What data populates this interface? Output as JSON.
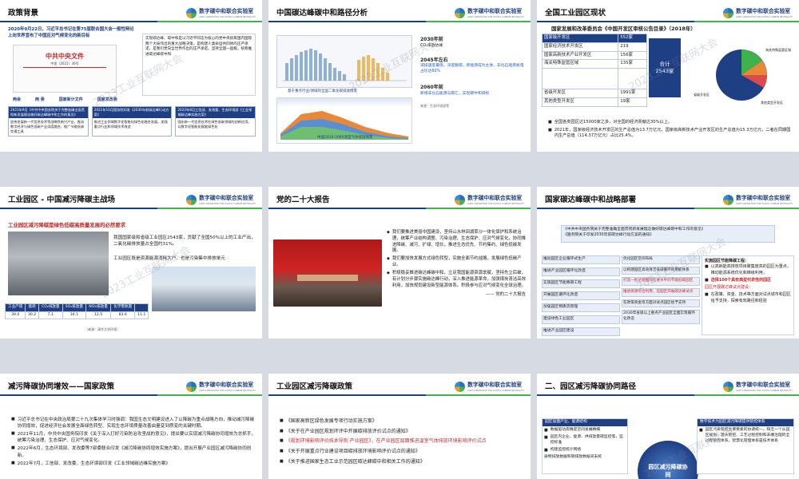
{
  "brand": {
    "name": "数字碳中和联合实验室",
    "en": "JOINT LABORATORY FOR DIGITAL CARBON NEUTRALITY"
  },
  "watermark": "2023工业互联网大会",
  "slides": [
    {
      "title": "政策背景",
      "intro": "2020年9月22日，习近平总书记在第75届联合国大会一般性辩论上向世界宣布了中国应对气候变化的新目标",
      "doc_title": "中共中央文件",
      "doc_num": "中发〔2021〕36号",
      "right_text": "实现碳达峰、碳中和是以习近平同志为核心的党中央统筹国内国际两个大局作出的重大战略决策，是构建人类命运共同体的庄严承诺，是我们党向全世界作出的庄严承诺。坚持全国一盘棋，统筹推进碳达峰碳中和",
      "labels": [
        "两会",
        "两 委",
        "国家新计文件",
        "国家发改委"
      ],
      "blocks": [
        {
          "head": "2021年9月《中共中央国务院关于完整准确全面贯彻新发展理念做好碳达峰碳中和工作的意见》",
          "body": "加快发展新一代信息技术等战略性新兴产业，推动数字经济与绿色低碳产业深度融合，推广节能低碳交通工具"
        },
        {
          "head": "2021年10月国务院印发《2030年前碳达峰行动方案》",
          "body": "推进工业领域数字化智能化绿色化融合发展，加强重点行业和领域技术改造"
        },
        {
          "head": "2022年8月工信部、发改委、生态环境部《工业领域碳达峰实施方案》",
          "body": "强化新一代信息技术在绿色低碳领域的创新应用，以数字化智能化赋能绿色化"
        }
      ]
    },
    {
      "title": "中国碳达峰碳中和路径分析",
      "chart_caption": "中国2020-2060温室气体排放情景",
      "chart_sub": "基于重点行业/领域的全国二氧化碳排放情景",
      "y2030": "2030年前",
      "t2030": "CO₂排放达峰",
      "y2045": "2045年左右",
      "t2045": "减排速度最快，深度脱碳，新能源成为主体，非化石能源发电占比达80%",
      "y2060": "2060年前",
      "t2060": "新增非化石能源与碳汇，实现碳中和目标",
      "source": "来源：生态环境部等"
    },
    {
      "title": "全国工业园区现状",
      "subtitle": "国家发展和改革委员会《中国开发区审核公告目录》（2018年）",
      "table": [
        [
          "国家级开发区",
          "552家"
        ],
        [
          "国家经济技术开发区",
          "219"
        ],
        [
          "国家高新技术产业开发区",
          "156家"
        ],
        [
          "海关特殊监管区域",
          "135家"
        ],
        [
          "",
          "",
          ""
        ],
        [
          "省级开发区",
          "1991家"
        ],
        [
          "其他类型开发区",
          "19家"
        ]
      ],
      "total_label": "合计",
      "total": "2543家",
      "pie_labels": [
        "海关特殊监管区域",
        "其他类型开发区",
        "省级开发区"
      ],
      "b1": "全国各类园区达15000家之多，对全国的经济贡献达30%以上。",
      "b2": "2021年，国家级经济技术开发区的生产总值为13.7万亿元，国家级高新技术产业开发区的生产总值为15.3万亿元，二者在同期国内生产总值（114.37万亿元）占比25.4%。"
    },
    {
      "title": "工业园区 - 中国减污降碳主战场",
      "headline": "工业园区减污降碳是绿色低碳高质量发展的必然要求",
      "t1": "我国国家级和省级工业园区2543家，贡献了全国50%以上的工业产出，二氧化碳排放量占全国约31%。",
      "t2": "工业园区既是资源能源消耗大户，也是污染集中排放单元",
      "table_head": [
        "工业产值",
        "能耗",
        "CO₂排放量",
        "SO₂排放量",
        "NOx排放量",
        "化学需氧量"
      ],
      "table_row": [
        "39.0",
        "30.2",
        "7.1",
        "34.1",
        "12.5",
        "83.6",
        "11.1"
      ],
      "source": "（来源：清华大学环境）"
    },
    {
      "title": "党的二十大报告",
      "p1": "我们要推进美丽中国建设，坚持山水林田湖草沙一体化保护和系统治理，统筹产业结构调整、污染治理、生态保护、应对气候变化，协同推进降碳、减污、扩绿、增长，推进生态优先、节约集约、绿色低碳发展。",
      "p2": "我们要加快发展方式绿色转型，实施全面节约战略，发展绿色低碳产业。",
      "p3": "积极稳妥推进碳达峰碳中和，立足我国能源资源禀赋，坚持先立后破，有计划分步骤实施碳达峰行动，深入推进能源革命，加强煤炭清洁高效利用，加快规划建设新型能源体系。积极参与应对气候变化全球治理。",
      "sign": "—— 党的二十大报告"
    },
    {
      "title": "国家碳达峰碳中和战略部署",
      "top1": "《中共中央国务院关于完整准确全面贯彻新发展理念做好碳达峰碳中和工作的意见》",
      "top2": "《国务院关于印发2030年前碳达峰行动方案的通知》",
      "left": [
        "推动园区企业循环式生产",
        "推进产业园区循环化改造",
        "实施园区节能降碳工程",
        "开展园区循环化改造",
        "加强园区物质流管理",
        "建设绿色工业园区",
        "推进产业园区建设"
      ],
      "mid": [
        "优化园区空间布局",
        "以构建园区高效清洁低碳循环的用能体系",
        "打造一批达到国际先进水平的节能低碳园区",
        "推进资源综合利用，在园区开展碳达峰试点",
        "在政策资金等方面对试点园区给予支持",
        "2030年省级以上重点产业园区全面实现循环化改造"
      ],
      "right_head": "实施园区节能降碳工程：",
      "right": [
        "以高耗能高排放项目聚集度高的园区为重点，推动能源系统优化和梯级利用，",
        "选择100个具有典型代表性的园区",
        "园区开展碳达峰试点建设：",
        "在政策、资金、技术等方面对试点城市和园区给予支持，探索有效路径和经验"
      ]
    },
    {
      "title": "减污降碳协同增效——国家政策",
      "items": [
        "习近平总书记在中央政治局第二十九次集体学习时强调：我国生态文明建设进入了以降碳为重点战略方向，推动减污降碳协同增效，促进经济社会发展全面绿色转型、实现生态环境质量改善由量变到质变的关键时期。",
        "2021年11月，中共中央国务院印发《关于深入打好污染防治攻坚战的意见》，提出要以实现减污降碳协同增效为总抓手，统筹污染治理、生态保护、应对气候变化。",
        "2022年6月，生态环境部、发改委等7部委联合印发《减污降碳协同增效实施方案》，提出开展产业园区减污降碳协同创新。",
        "2022年7月，工信部、发改委、生态环境部印发《工业领域碳达峰实施方案》"
      ]
    },
    {
      "title": "工业园区减污降碳政策",
      "items": [
        "《国家高新区绿色发展专项行动实施方案》",
        "《关于在产业园区规划环评中开展碳排放评价试点的通知》",
        "《规划环境影响评价技术导则 产业园区》，在产业园区层面推进温室气体排放环境影响评价试点",
        "《关于开展重点行业建设项目碳排放环境影响评价试点的通知》",
        "《关于推进国家生态工业示范园区碳达峰碳中和相关工作的通知》"
      ]
    },
    {
      "title": "二、园区减污降碳协同路径",
      "l_head": "园区层面产业、能源结构",
      "l_items": [
        "数据驱动高精度空间发展精细",
        "园区内企业、能源、供排放量碳监控等，监控标准",
        "构建监控统计网络"
      ],
      "l_foot": "染物排放数据和碳排放数据间未统",
      "center": "园区减污降碳协同",
      "r_head": "数字技术为园区减污降碳提供管控体系",
      "r_items": [
        "园区污染管控主要要素的协调统一，缺乏一个从园区规划、源头管控、工艺过程控制和末端治理的全过程管控体系，智慧化管理体系是技术体系"
      ]
    }
  ]
}
